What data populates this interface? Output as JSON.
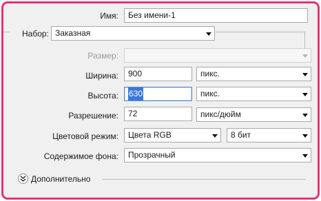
{
  "form": {
    "name": {
      "label": "Имя:",
      "value": "Без имени-1"
    },
    "preset": {
      "label": "Набор:",
      "value": "Заказная"
    },
    "size": {
      "label": "Размер:",
      "value": ""
    },
    "width": {
      "label": "Ширина:",
      "value": "900",
      "unit": "пикс."
    },
    "height": {
      "label": "Высота:",
      "value": "630",
      "unit": "пикс."
    },
    "resolution": {
      "label": "Разрешение:",
      "value": "72",
      "unit": "пикс/дюйм"
    },
    "color_mode": {
      "label": "Цветовой режим:",
      "value": "Цвета RGB",
      "depth": "8 бит"
    },
    "background": {
      "label": "Содержимое фона:",
      "value": "Прозрачный"
    },
    "advanced": {
      "label": "Дополнительно"
    }
  },
  "colors": {
    "accent_border": "#e8336a",
    "selection": "#3b78d8"
  }
}
